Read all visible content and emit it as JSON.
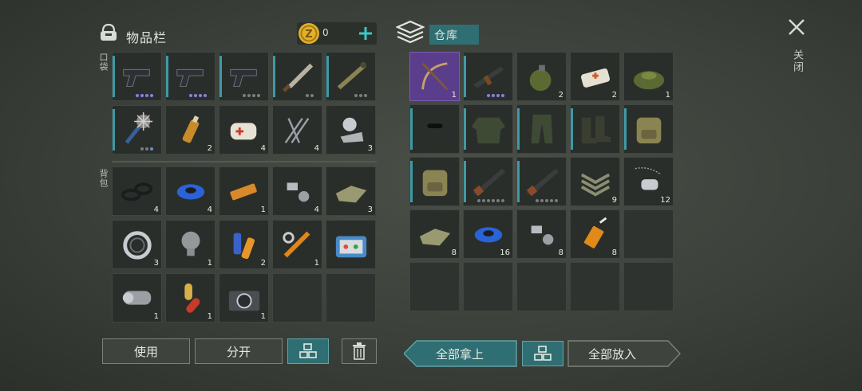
{
  "inventory": {
    "title": "物品栏",
    "coins": "0",
    "pocket_label": "口袋",
    "backpack_label": "背包",
    "pocket": [
      {
        "name": "pistol-1",
        "icon": "pistol-icon",
        "dots": [
          "on",
          "on",
          "on",
          "on"
        ],
        "bar": true
      },
      {
        "name": "pistol-2",
        "icon": "pistol-icon",
        "dots": [
          "on",
          "on",
          "on",
          "on"
        ],
        "bar": true
      },
      {
        "name": "pistol-3",
        "icon": "pistol-icon",
        "dots": [
          "",
          "",
          "",
          ""
        ],
        "bar": true
      },
      {
        "name": "machete",
        "icon": "machete-icon",
        "dots": [
          "",
          ""
        ],
        "bar": true
      },
      {
        "name": "rocket-launcher",
        "icon": "rocket-launcher-icon",
        "dots": [
          "",
          "",
          ""
        ],
        "bar": true
      },
      {
        "name": "spiked-club",
        "icon": "spiked-club-icon",
        "dots": [
          "",
          "",
          "blue"
        ],
        "bar": true
      },
      {
        "name": "ammo-bottle",
        "icon": "bottle-icon",
        "count": "2"
      },
      {
        "name": "bandage",
        "icon": "bandage-icon",
        "count": "4"
      },
      {
        "name": "nails",
        "icon": "nails-icon",
        "count": "4"
      },
      {
        "name": "scrap-parts",
        "icon": "scrap-icon",
        "count": "3"
      }
    ],
    "backpack": [
      {
        "name": "rubber-rings",
        "icon": "rings-icon",
        "count": "4"
      },
      {
        "name": "blue-tape",
        "icon": "tape-icon",
        "count": "4"
      },
      {
        "name": "battery-pack",
        "icon": "battery-icon",
        "count": "1"
      },
      {
        "name": "bolts",
        "icon": "bolt-icon",
        "count": "4"
      },
      {
        "name": "cloth",
        "icon": "cloth-icon",
        "count": "3"
      },
      {
        "name": "bearing",
        "icon": "bearing-icon",
        "count": "3"
      },
      {
        "name": "light-bulb",
        "icon": "bulb-icon",
        "count": "1"
      },
      {
        "name": "batteries",
        "icon": "batteries-icon",
        "count": "2"
      },
      {
        "name": "hydraulic-parts",
        "icon": "hydraulic-icon",
        "count": "1"
      },
      {
        "name": "toolbox",
        "icon": "toolbox-icon",
        "count": ""
      },
      {
        "name": "metal-sheet",
        "icon": "sheet-icon",
        "count": "1"
      },
      {
        "name": "pills",
        "icon": "pills-icon",
        "count": "1"
      },
      {
        "name": "camera",
        "icon": "camera-icon",
        "count": "1"
      },
      {
        "name": "empty",
        "icon": "",
        "count": ""
      },
      {
        "name": "empty",
        "icon": "",
        "count": ""
      }
    ],
    "buttons": {
      "use": "使用",
      "split": "分开"
    }
  },
  "storage": {
    "title": "仓库",
    "items": [
      {
        "name": "crossbow-card",
        "icon": "crossbow-icon",
        "count": "1",
        "purple": true
      },
      {
        "name": "assault-rifle",
        "icon": "rifle-icon",
        "dots": [
          "on",
          "on",
          "on",
          "on"
        ],
        "bar": true
      },
      {
        "name": "grenade",
        "icon": "grenade-icon",
        "count": "2"
      },
      {
        "name": "first-aid-box",
        "icon": "medbox-icon",
        "count": "2"
      },
      {
        "name": "landmine",
        "icon": "landmine-icon",
        "count": "1"
      },
      {
        "name": "balaclava",
        "icon": "balaclava-icon",
        "bar": true
      },
      {
        "name": "camo-jacket",
        "icon": "jacket-icon",
        "bar": true
      },
      {
        "name": "camo-pants",
        "icon": "pants-icon",
        "bar": true
      },
      {
        "name": "boots",
        "icon": "boots-icon",
        "bar": true
      },
      {
        "name": "backpack-1",
        "icon": "backpack-icon",
        "bar": true
      },
      {
        "name": "backpack-2",
        "icon": "backpack-icon",
        "bar": true
      },
      {
        "name": "shotgun-1",
        "icon": "shotgun-icon",
        "dots": [
          "",
          "",
          "",
          "",
          "",
          ""
        ],
        "bar": true
      },
      {
        "name": "shotgun-2",
        "icon": "shotgun-icon",
        "dots": [
          "",
          "",
          "",
          "",
          ""
        ],
        "bar": true
      },
      {
        "name": "sergeant-patch",
        "icon": "patch-icon",
        "count": "9"
      },
      {
        "name": "dog-tags",
        "icon": "dogtag-icon",
        "count": "12"
      },
      {
        "name": "cloth",
        "icon": "cloth-icon",
        "count": "8"
      },
      {
        "name": "blue-tape",
        "icon": "tape-icon",
        "count": "16"
      },
      {
        "name": "bolts",
        "icon": "bolt-icon",
        "count": "8"
      },
      {
        "name": "glue",
        "icon": "glue-icon",
        "count": "8"
      },
      {
        "name": "empty",
        "icon": "",
        "count": ""
      }
    ],
    "buttons": {
      "take_all": "全部拿上",
      "put_all": "全部放入"
    }
  },
  "close_label": "关闭",
  "colors": {
    "accent": "#2f6f73",
    "bar": "#3e9aa6",
    "purple": "#5a3e8c"
  }
}
